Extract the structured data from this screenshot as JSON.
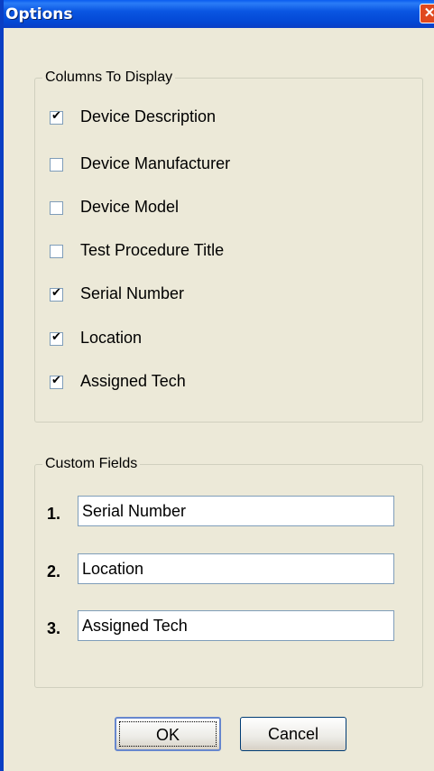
{
  "window": {
    "title": "Options",
    "close_glyph": "✕"
  },
  "columns_group": {
    "title": "Columns To Display",
    "items": [
      {
        "label": "Device Description",
        "checked": true
      },
      {
        "label": "Device Manufacturer",
        "checked": false
      },
      {
        "label": "Device Model",
        "checked": false
      },
      {
        "label": "Test Procedure Title",
        "checked": false
      },
      {
        "label": "Serial Number",
        "checked": true
      },
      {
        "label": "Location",
        "checked": true
      },
      {
        "label": "Assigned Tech",
        "checked": true
      }
    ]
  },
  "custom_fields_group": {
    "title": "Custom Fields",
    "fields": [
      {
        "number": "1.",
        "value": "Serial Number"
      },
      {
        "number": "2.",
        "value": "Location"
      },
      {
        "number": "3.",
        "value": "Assigned Tech"
      }
    ]
  },
  "buttons": {
    "ok": "OK",
    "cancel": "Cancel"
  }
}
